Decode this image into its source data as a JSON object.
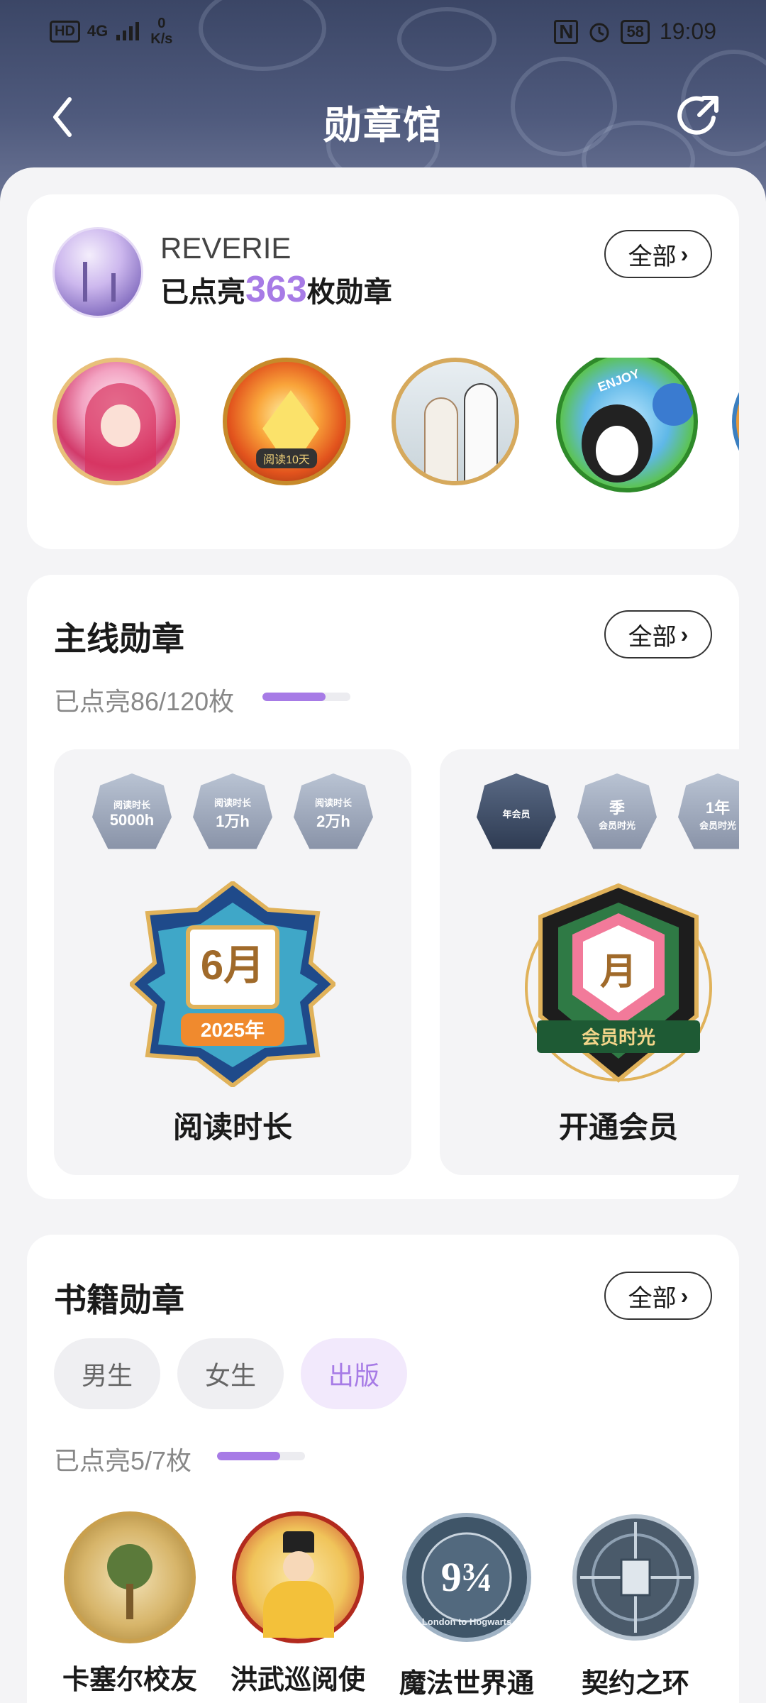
{
  "status_bar": {
    "hd": "HD",
    "network": "4G",
    "speed_value": "0",
    "speed_unit": "K/s",
    "nfc": "N",
    "battery": "58",
    "time": "19:09"
  },
  "header": {
    "title": "勋章馆",
    "back_icon": "chevron-left-icon",
    "share_icon": "share-icon"
  },
  "profile_card": {
    "username": "REVERIE",
    "lit_prefix": "已点亮",
    "lit_count": "363",
    "lit_suffix": "枚勋章",
    "all_button": "全部",
    "badges": [
      {
        "name": "anime-girl-badge"
      },
      {
        "name": "phoenix-badge",
        "label": "阅读10天"
      },
      {
        "name": "couple-badge"
      },
      {
        "name": "penguin-enjoy-badge",
        "label": "ENJOY"
      },
      {
        "name": "partial-badge"
      }
    ]
  },
  "main_badges": {
    "title": "主线勋章",
    "all_button": "全部",
    "progress_text": "已点亮86/120枚",
    "progress_fraction": 0.717,
    "cards": [
      {
        "label": "阅读时长",
        "mini": [
          {
            "t1": "阅读时长",
            "t2": "5000h"
          },
          {
            "t1": "阅读时长",
            "t2": "1万h"
          },
          {
            "t1": "阅读时长",
            "t2": "2万h"
          }
        ],
        "hero_main": "6月",
        "hero_sub": "2025年"
      },
      {
        "label": "开通会员",
        "mini": [
          {
            "t1": "年会员",
            "t2": ""
          },
          {
            "t1": "会员时光",
            "t2": "季"
          },
          {
            "t1": "会员时光",
            "t2": "1年"
          }
        ],
        "hero_main": "月",
        "hero_sub": "会员时光"
      }
    ]
  },
  "book_badges": {
    "title": "书籍勋章",
    "all_button": "全部",
    "tabs": [
      "男生",
      "女生",
      "出版"
    ],
    "active_tab": "出版",
    "progress_text": "已点亮5/7枚",
    "progress_fraction": 0.714,
    "items": [
      {
        "name": "卡塞尔校友"
      },
      {
        "name": "洪武巡阅使"
      },
      {
        "name": "魔法世界通",
        "emblem": "9¾",
        "emblem_sub": "London to Hogwarts"
      },
      {
        "name": "契约之环"
      }
    ]
  },
  "colors": {
    "accent": "#a77be6",
    "header_bg": "#3b4666",
    "page_bg": "#f4f4f6"
  }
}
